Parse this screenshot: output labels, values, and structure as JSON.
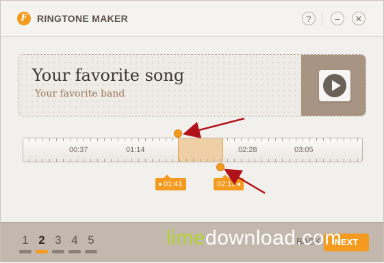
{
  "window": {
    "title": "RINGTONE MAKER",
    "logo_letter": "F"
  },
  "titlebar_buttons": {
    "help": "?",
    "minimize": "–",
    "close": "✕"
  },
  "song": {
    "title": "Your favorite song",
    "band": "Your favorite band"
  },
  "timeline": {
    "labels": [
      "00:37",
      "01:14",
      "02:28",
      "03:05"
    ],
    "start_time": "01:41",
    "end_time": "02:11"
  },
  "steps": [
    "1",
    "2",
    "3",
    "4",
    "5"
  ],
  "active_step": 2,
  "footer": {
    "back_label": "BACK",
    "next_label": "NEXT"
  },
  "watermark": {
    "part1": "lime",
    "part2": "download.com"
  },
  "colors": {
    "accent": "#f39a1f",
    "annotation_arrow": "#b0141a"
  }
}
